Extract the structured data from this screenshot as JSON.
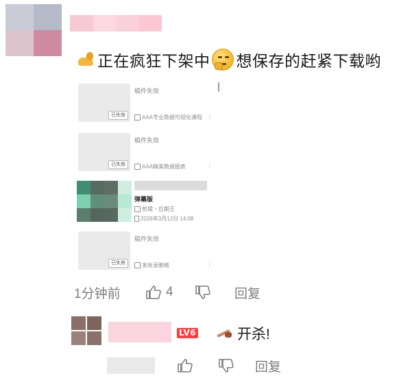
{
  "comment": {
    "text": "正在疯狂下架中",
    "text_after_emoji": "想保存的赶紧下载哟",
    "emojis": [
      "flexed-biceps-emoji",
      "thinking-emoji"
    ],
    "embedded_screenshot": {
      "items": [
        {
          "title": "稿件失效",
          "badge": "已失效",
          "meta": "AAA专业数据可视化课程"
        },
        {
          "title": "稿件失效",
          "badge": "已失效",
          "meta": "AAA精美数据图表"
        },
        {
          "title": "弹幕版",
          "authors": "剪辑丶后期王",
          "date": "2026年3月12日 14:08"
        },
        {
          "title": "稿件失效",
          "badge": "已失效",
          "meta": "发收录删格"
        }
      ]
    },
    "time": "1分钟前",
    "like_count": "4",
    "reply_label": "回复"
  },
  "reply": {
    "level": "LV6",
    "text": "开杀!",
    "reply_label": "回复"
  },
  "colors": {
    "level_badge": "#ff3b3b",
    "action_gray": "#7d7d7d"
  }
}
